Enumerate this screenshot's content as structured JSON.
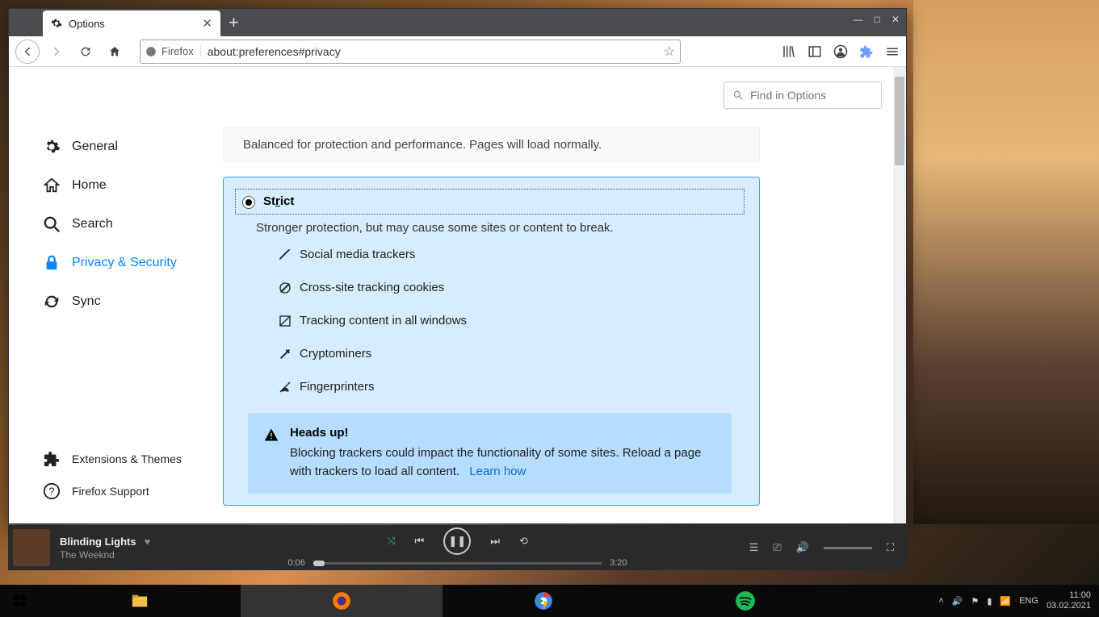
{
  "tab": {
    "title": "Options"
  },
  "urlbar": {
    "identity": "Firefox",
    "address": "about:preferences#privacy"
  },
  "search": {
    "placeholder": "Find in Options"
  },
  "sidebar": {
    "items": [
      {
        "label": "General"
      },
      {
        "label": "Home"
      },
      {
        "label": "Search"
      },
      {
        "label": "Privacy & Security"
      },
      {
        "label": "Sync"
      }
    ],
    "bottom": [
      {
        "label": "Extensions & Themes"
      },
      {
        "label": "Firefox Support"
      }
    ]
  },
  "standard": {
    "desc": "Balanced for protection and performance. Pages will load normally."
  },
  "strict": {
    "label": "Strict",
    "desc": "Stronger protection, but may cause some sites or content to break.",
    "blocks": [
      "Social media trackers",
      "Cross-site tracking cookies",
      "Tracking content in all windows",
      "Cryptominers",
      "Fingerprinters"
    ]
  },
  "headsup": {
    "title": "Heads up!",
    "body": "Blocking trackers could impact the functionality of some sites. Reload a page with trackers to load all content.",
    "link": "Learn how"
  },
  "music": {
    "title": "Blinding Lights",
    "artist": "The Weeknd",
    "elapsed": "0:06",
    "total": "3:20"
  },
  "systray": {
    "lang": "ENG",
    "time": "11:00",
    "date": "03.02.2021"
  }
}
